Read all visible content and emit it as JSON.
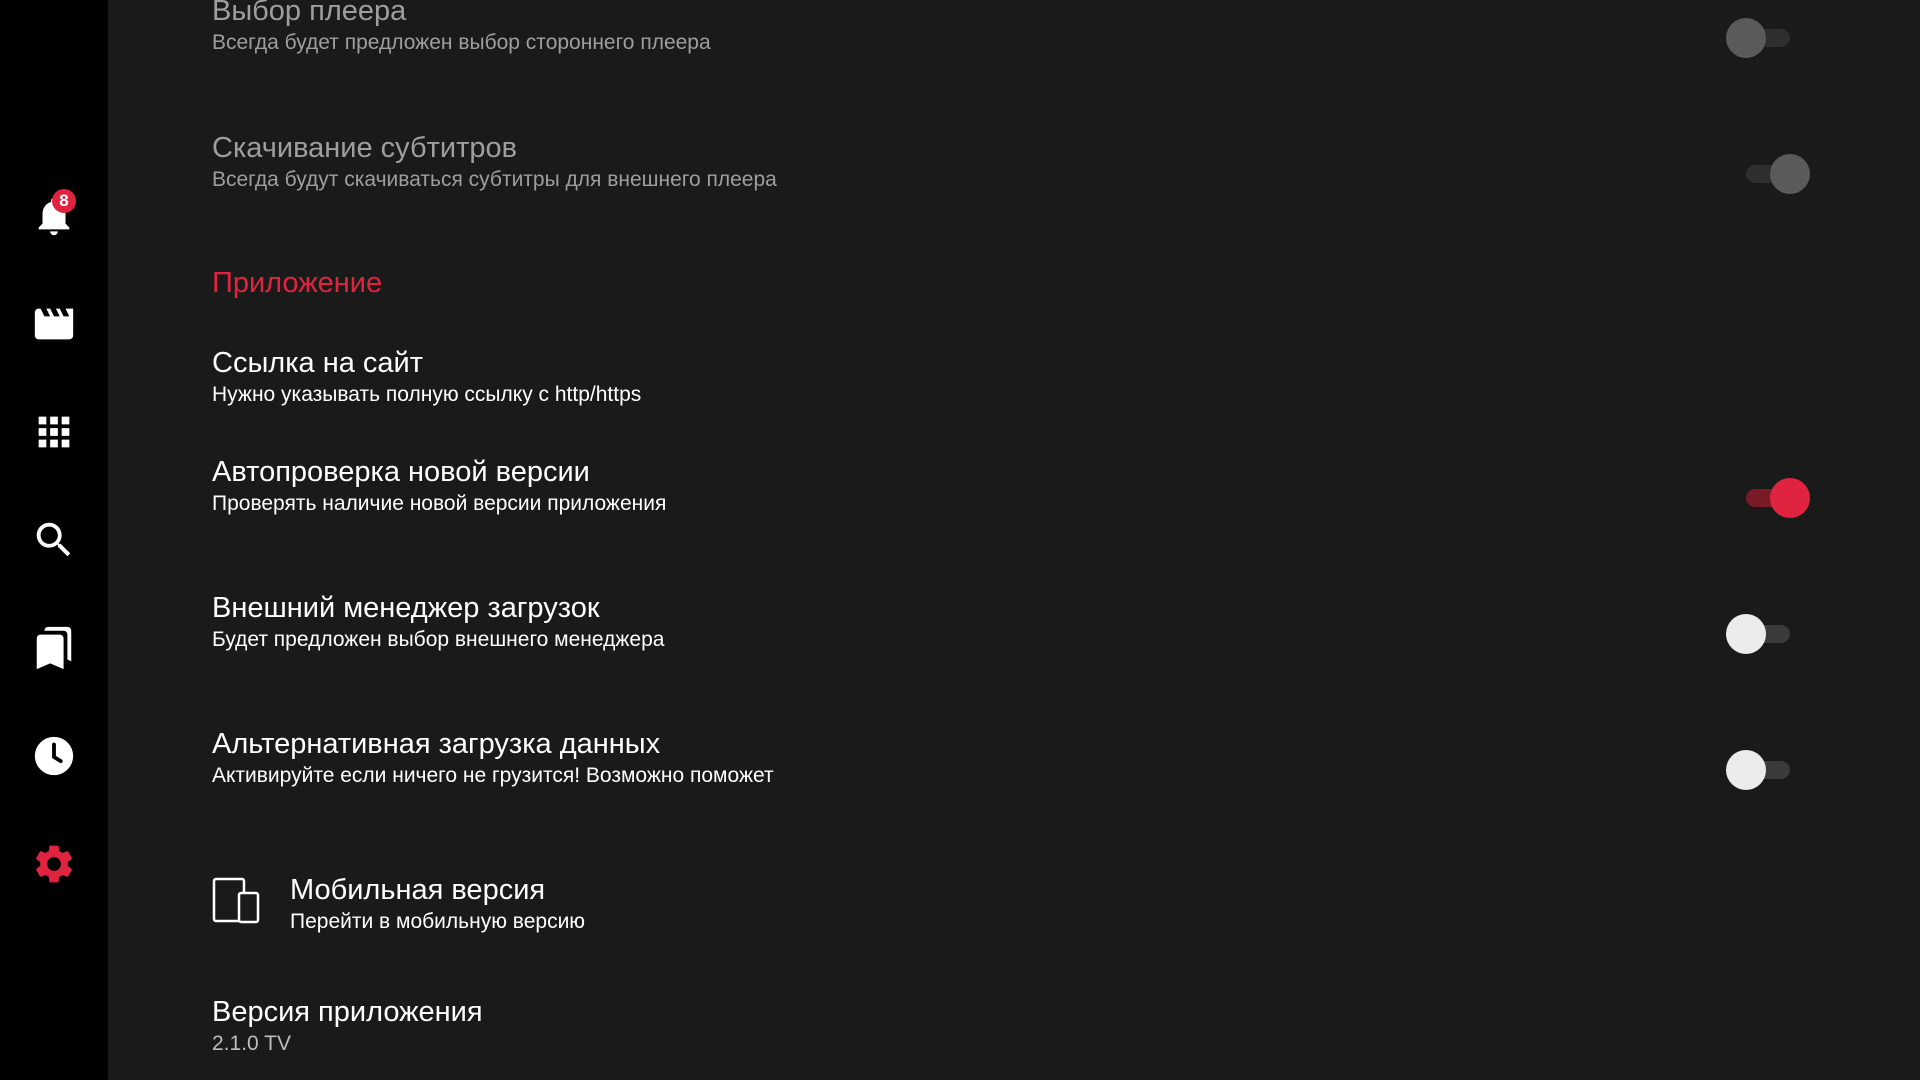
{
  "sidebar": {
    "notifications": {
      "icon": "bell-icon",
      "badge": "8"
    },
    "items": [
      {
        "icon": "movie-clapper-icon"
      },
      {
        "icon": "grid-apps-icon"
      },
      {
        "icon": "search-icon"
      },
      {
        "icon": "bookmarks-icon"
      },
      {
        "icon": "clock-history-icon"
      },
      {
        "icon": "gear-icon",
        "active": true
      }
    ]
  },
  "colors": {
    "accent": "#e0243f",
    "background": "#1a1a1a",
    "sidebar": "#000000"
  },
  "settings": {
    "player_choice": {
      "title": "Выбор плеера",
      "subtitle": "Всегда будет предложен выбор стороннего плеера",
      "enabled": false,
      "disabled_state": true
    },
    "subtitles_download": {
      "title": "Скачивание субтитров",
      "subtitle": "Всегда будут скачиваться субтитры для внешнего плеера",
      "enabled": true,
      "disabled_state": true
    },
    "app_section": {
      "header": "Приложение"
    },
    "site_link": {
      "title": "Ссылка на сайт",
      "subtitle": "Нужно указывать полную ссылку с http/https"
    },
    "auto_update": {
      "title": "Автопроверка новой версии",
      "subtitle": "Проверять наличие новой версии приложения",
      "enabled": true
    },
    "external_downloader": {
      "title": "Внешний менеджер загрузок",
      "subtitle": "Будет предложен выбор внешнего менеджера",
      "enabled": false
    },
    "alt_loading": {
      "title": "Альтернативная загрузка данных",
      "subtitle": "Активируйте если ничего не грузится! Возможно поможет",
      "enabled": false
    },
    "mobile_version": {
      "icon": "mobile-tablet-icon",
      "title": "Мобильная версия",
      "subtitle": "Перейти в мобильную версию"
    },
    "app_version": {
      "title": "Версия приложения",
      "value": "2.1.0 TV"
    }
  }
}
